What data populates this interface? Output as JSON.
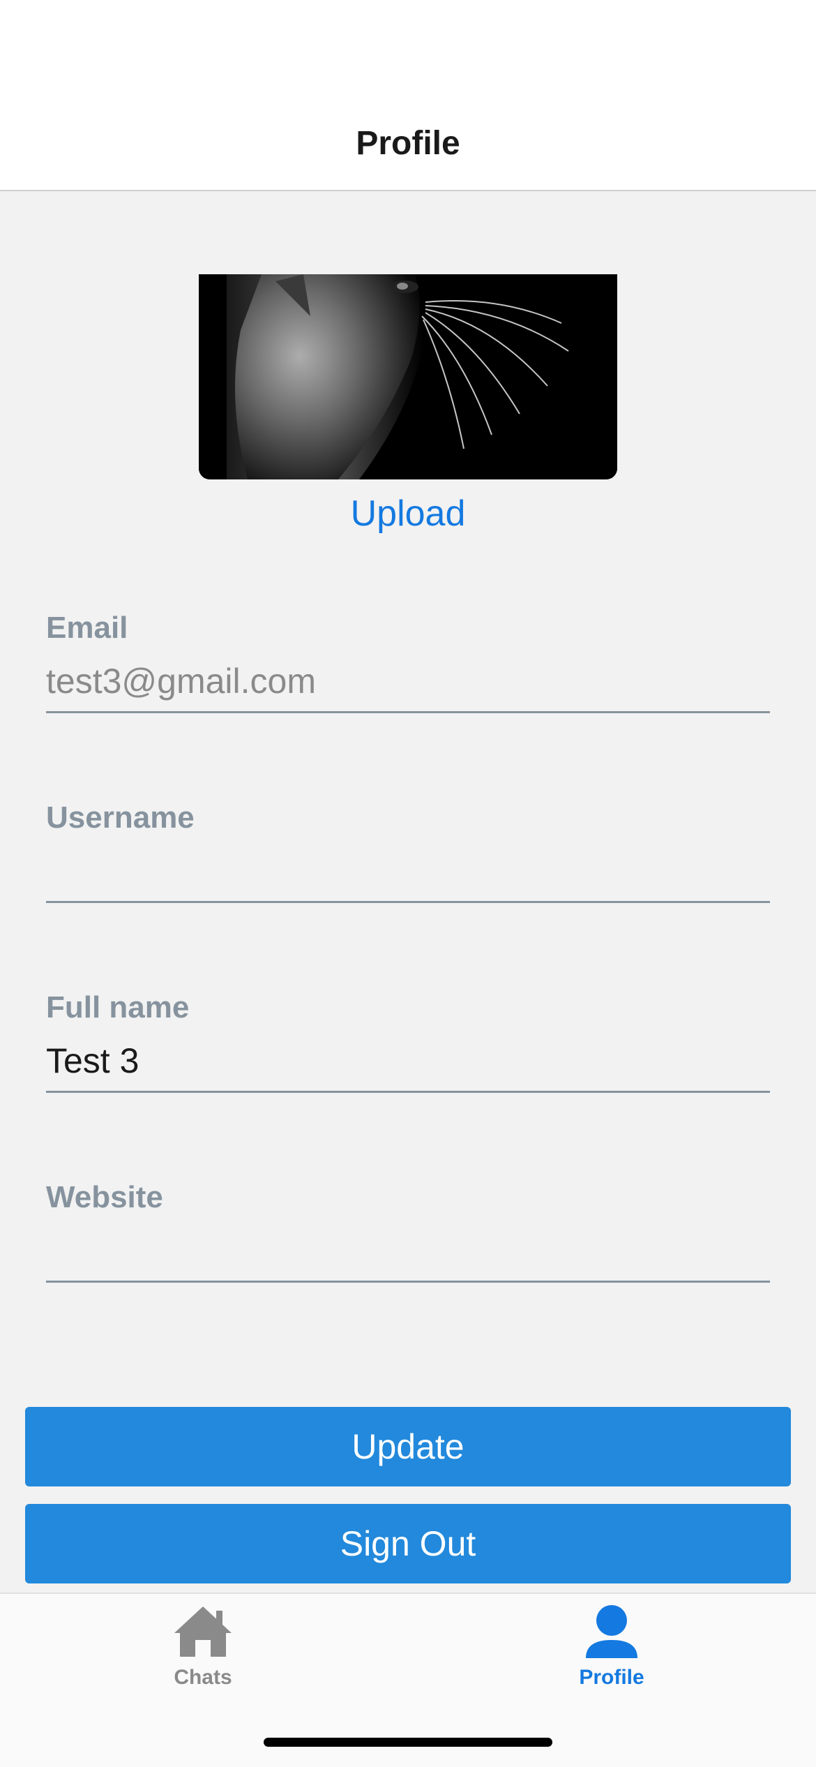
{
  "header": {
    "title": "Profile"
  },
  "avatar": {
    "alt": "cat photo",
    "caption": ""
  },
  "upload_label": "Upload",
  "fields": [
    {
      "label": "Email",
      "value": "test3@gmail.com",
      "placeholder": "",
      "disabled": true
    },
    {
      "label": "Username",
      "value": "",
      "placeholder": ""
    },
    {
      "label": "Full name",
      "value": "Test 3",
      "placeholder": ""
    },
    {
      "label": "Website",
      "value": "",
      "placeholder": ""
    }
  ],
  "buttons": {
    "update": "Update",
    "sign_out": "Sign Out"
  },
  "tabbar": {
    "tabs": [
      {
        "label": "Chats",
        "icon": "home-icon",
        "active": false
      },
      {
        "label": "Profile",
        "icon": "person-icon",
        "active": true
      }
    ],
    "active_color": "#1479e0",
    "inactive_color": "#8a8a8a"
  },
  "colors": {
    "button": "#2289dc",
    "label": "#86939e",
    "link": "#1479e0"
  }
}
